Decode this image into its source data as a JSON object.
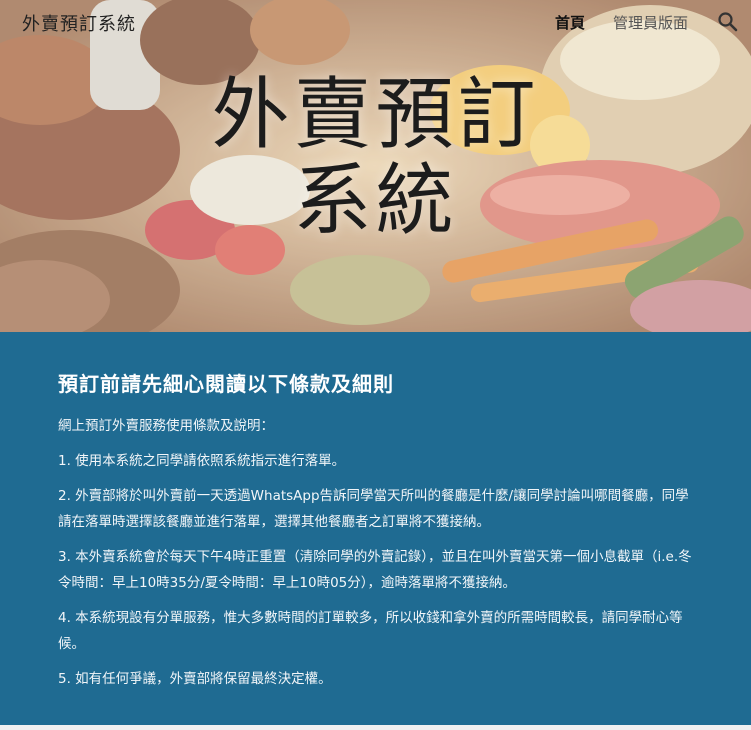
{
  "header": {
    "site_title": "外賣預訂系統",
    "nav": [
      {
        "label": "首頁",
        "active": true
      },
      {
        "label": "管理員版面",
        "active": false
      }
    ],
    "search_icon": "search-icon"
  },
  "hero": {
    "title_line1": "外賣預訂",
    "title_line2": "系統"
  },
  "terms": {
    "heading": "預訂前請先細心閱讀以下條款及細則",
    "intro": "網上預訂外賣服務使用條款及說明：",
    "items": [
      "1. 使用本系統之同學請依照系統指示進行落單。",
      "2. 外賣部將於叫外賣前一天透過WhatsApp告訴同學當天所叫的餐廳是什麼/讓同學討論叫哪間餐廳，同學請在落單時選擇該餐廳並進行落單，選擇其他餐廳者之訂單將不獲接納。",
      "3. 本外賣系統會於每天下午4時正重置（清除同學的外賣記錄），並且在叫外賣當天第一個小息截單（i.e.冬令時間：早上10時35分/夏令時間：早上10時05分），逾時落單將不獲接納。",
      "4. 本系統現設有分單服務，惟大多數時間的訂單較多，所以收錢和拿外賣的所需時間較長，請同學耐心等候。",
      "5. 如有任何爭議，外賣部將保留最終決定權。"
    ]
  },
  "colors": {
    "content_bg": "#1f6b92",
    "text_on_blue": "#ffffff"
  }
}
